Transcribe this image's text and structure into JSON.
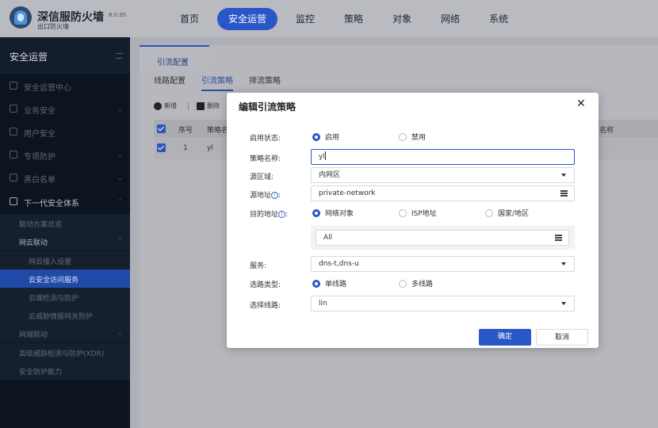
{
  "brand": {
    "title": "深信服防火墙",
    "subtitle": "出口防火墙",
    "version": "8.0.95"
  },
  "nav": [
    "首页",
    "安全运营",
    "监控",
    "策略",
    "对象",
    "网络",
    "系统"
  ],
  "sidebar": {
    "title": "安全运营",
    "items": [
      "安全运营中心",
      "业务安全",
      "用户安全",
      "专项防护",
      "黑白名单",
      "下一代安全体系"
    ],
    "subitems": [
      "联动方案总览",
      "网云联动",
      "网云接入设置",
      "云安全访问服务",
      "云端检测与防护",
      "云威胁情报网关防护",
      "网端联动",
      "高级威胁检测与防护(XDR)",
      "安全防护能力"
    ]
  },
  "content": {
    "main_tab": "引流配置",
    "sub_tabs": [
      "线路配置",
      "引流策略",
      "排流策略"
    ],
    "toolbar": {
      "add": "新增",
      "delete": "删除"
    },
    "columns": {
      "index": "序号",
      "name": "策略名",
      "extra": "名称"
    },
    "row": {
      "index": "1",
      "name": "yl"
    }
  },
  "modal": {
    "title": "编辑引流策略",
    "close": "✕",
    "status": {
      "label": "启用状态:",
      "options": [
        "启用",
        "禁用"
      ],
      "selected": "启用"
    },
    "name": {
      "label": "策略名称:",
      "value": "yl"
    },
    "src_zone": {
      "label": "源区域:",
      "value": "内网区"
    },
    "src_addr": {
      "label": "源地址",
      "value": "private-network"
    },
    "dst_addr": {
      "label": "目的地址",
      "options": [
        "网络对象",
        "ISP地址",
        "国家/地区"
      ],
      "selected": "网络对象",
      "value": "All"
    },
    "service": {
      "label": "服务:",
      "value": "dns-t,dns-u"
    },
    "route_type": {
      "label": "选路类型:",
      "options": [
        "单线路",
        "多线路"
      ],
      "selected": "单线路"
    },
    "route": {
      "label": "选择线路:",
      "value": "lin"
    },
    "confirm": "确定",
    "cancel": "取消"
  },
  "colors": {
    "accent": "#2a57c8",
    "sidebar_bg": "#0c1420",
    "active_sub": "#1f4aa8"
  },
  "icons": [
    "info-icon",
    "list-icon",
    "dropdown-arrow-icon",
    "close-icon",
    "add-icon",
    "delete-icon",
    "menu-collapse-icon"
  ]
}
